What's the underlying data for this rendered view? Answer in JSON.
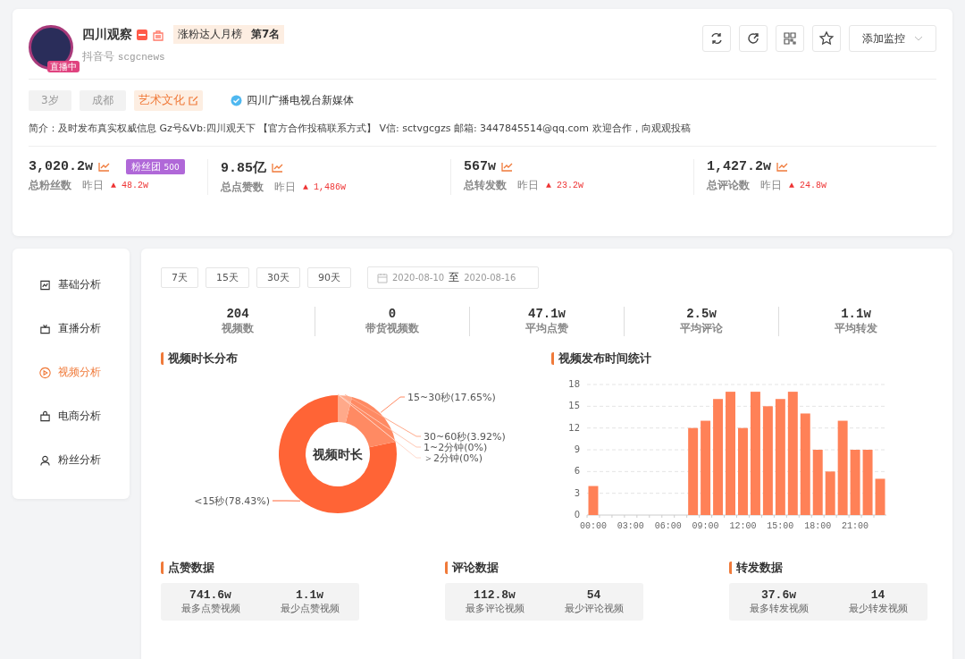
{
  "profile": {
    "name": "四川观察",
    "live_badge": "直播中",
    "rank_label": "涨粉达人月榜",
    "rank_value": "第7名",
    "account_label": "抖音号",
    "account_id": "scgcnews",
    "tags": [
      {
        "label": "3岁",
        "kind": "plain"
      },
      {
        "label": "成都",
        "kind": "plain"
      },
      {
        "label": "艺术文化",
        "kind": "category"
      }
    ],
    "verified": "四川广播电视台新媒体",
    "bio": "简介：及时发布真实权威信息 Gz号&Vb:四川观天下 【官方合作投稿联系方式】 V信: sctvgcgzs 邮箱: 3447845514@qq.com 欢迎合作，向观观投稿"
  },
  "actions": {
    "monitor": "添加监控"
  },
  "stats": [
    {
      "value": "3,020.2w",
      "label": "总粉丝数",
      "yesterday": "昨日",
      "delta": "▲ 48.2w",
      "badge": "粉丝团",
      "badge_count": "500"
    },
    {
      "value": "9.85亿",
      "label": "总点赞数",
      "yesterday": "昨日",
      "delta": "▲ 1,486w"
    },
    {
      "value": "567w",
      "label": "总转发数",
      "yesterday": "昨日",
      "delta": "▲ 23.2w"
    },
    {
      "value": "1,427.2w",
      "label": "总评论数",
      "yesterday": "昨日",
      "delta": "▲ 24.8w"
    }
  ],
  "sidebar": {
    "items": [
      {
        "label": "基础分析",
        "selected": false,
        "kind": "chart"
      },
      {
        "label": "直播分析",
        "selected": false,
        "kind": "live"
      },
      {
        "label": "视频分析",
        "selected": true,
        "kind": "video"
      },
      {
        "label": "电商分析",
        "selected": false,
        "kind": "shop"
      },
      {
        "label": "粉丝分析",
        "selected": false,
        "kind": "fans"
      }
    ]
  },
  "ranges": [
    {
      "label": "7天",
      "selected": false
    },
    {
      "label": "15天",
      "selected": false
    },
    {
      "label": "30天",
      "selected": false
    },
    {
      "label": "90天",
      "selected": false
    }
  ],
  "date_range": {
    "start": "2020-08-10",
    "separator": "至",
    "end": "2020-08-16"
  },
  "summary": [
    {
      "value": "204",
      "label": "视频数"
    },
    {
      "value": "0",
      "label": "带货视频数"
    },
    {
      "value": "47.1w",
      "label": "平均点赞"
    },
    {
      "value": "2.5w",
      "label": "平均评论"
    },
    {
      "value": "1.1w",
      "label": "平均转发"
    }
  ],
  "duration_chart": {
    "title": "视频时长分布",
    "center_label": "视频时长",
    "chart_data": {
      "type": "donut",
      "categories": [
        "<15秒(78.43%)",
        "15~30秒(17.65%)",
        "30~60秒(3.92%)",
        "1~2分钟(0%)",
        "＞2分钟(0%)"
      ],
      "values": [
        78.43,
        17.65,
        3.92,
        0,
        0
      ]
    }
  },
  "time_chart": {
    "title": "视频发布时间统计",
    "chart_data": {
      "type": "bar",
      "x": [
        0,
        1,
        2,
        3,
        4,
        5,
        6,
        7,
        8,
        9,
        10,
        11,
        12,
        13,
        14,
        15,
        16,
        17,
        18,
        19,
        20,
        21,
        22,
        23
      ],
      "values": [
        4,
        0,
        0,
        0,
        0,
        0,
        0,
        0,
        12,
        13,
        16,
        17,
        12,
        17,
        15,
        16,
        17,
        14,
        9,
        6,
        13,
        9,
        9,
        5
      ],
      "xlim": [
        -0.5,
        23.5
      ],
      "ylim": [
        0,
        18
      ],
      "grid": true,
      "yticks": [
        0,
        3,
        6,
        9,
        12,
        15,
        18
      ],
      "xticks": [
        {
          "value": 0,
          "label": "00:00"
        },
        {
          "value": 3,
          "label": "03:00"
        },
        {
          "value": 6,
          "label": "06:00"
        },
        {
          "value": 9,
          "label": "09:00"
        },
        {
          "value": 12,
          "label": "12:00"
        },
        {
          "value": 15,
          "label": "15:00"
        },
        {
          "value": 18,
          "label": "18:00"
        },
        {
          "value": 21,
          "label": "21:00"
        }
      ]
    }
  },
  "metric_panels": [
    {
      "title": "点赞数据",
      "items": [
        {
          "value": "741.6w",
          "label": "最多点赞视频"
        },
        {
          "value": "1.1w",
          "label": "最少点赞视频"
        }
      ]
    },
    {
      "title": "评论数据",
      "items": [
        {
          "value": "112.8w",
          "label": "最多评论视频"
        },
        {
          "value": "54",
          "label": "最少评论视频"
        }
      ]
    },
    {
      "title": "转发数据",
      "items": [
        {
          "value": "37.6w",
          "label": "最多转发视频"
        },
        {
          "value": "14",
          "label": "最少转发视频"
        }
      ]
    }
  ]
}
